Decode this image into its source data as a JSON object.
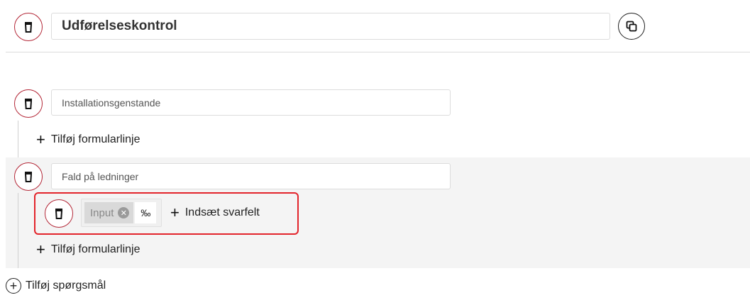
{
  "header": {
    "title_value": "Udførelseskontrol"
  },
  "questions": [
    {
      "value": "Installationsgenstande",
      "add_line_label": "Tilføj formularlinje"
    },
    {
      "value": "Fald på ledninger",
      "answer_line": {
        "chip_label": "Input",
        "unit": "‰",
        "insert_label": "Indsæt svarfelt"
      },
      "add_line_label": "Tilføj formularlinje"
    }
  ],
  "add_question_label": "Tilføj spørgsmål",
  "colors": {
    "accent_red": "#b32636",
    "highlight_red": "#e3242b",
    "section_bg": "#f4f4f4"
  },
  "icons": [
    "trash-icon",
    "copy-icon",
    "plus-icon",
    "close-circle-icon",
    "plus-circle-icon"
  ]
}
